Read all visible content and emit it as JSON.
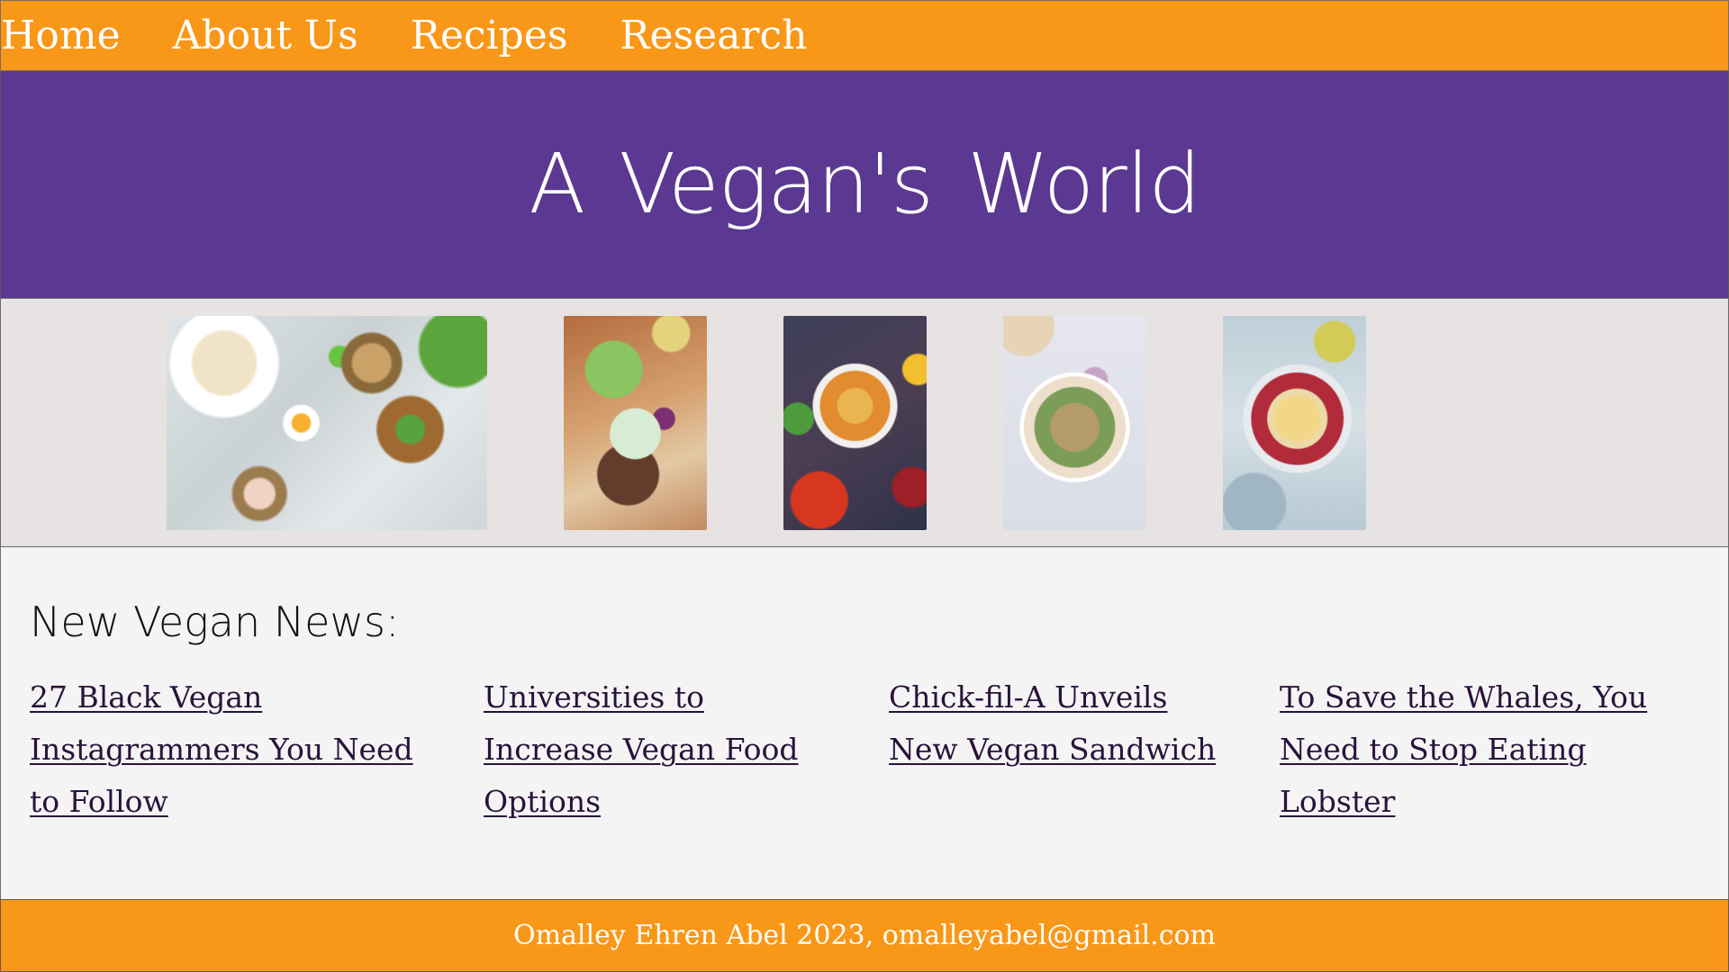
{
  "nav": {
    "items": [
      {
        "label": "Home"
      },
      {
        "label": "About Us"
      },
      {
        "label": "Recipes"
      },
      {
        "label": "Research"
      }
    ]
  },
  "header": {
    "title": "A Vegan's World"
  },
  "gallery": {
    "images": [
      {
        "icon": "food-photo"
      },
      {
        "icon": "food-photo"
      },
      {
        "icon": "food-photo"
      },
      {
        "icon": "food-photo"
      },
      {
        "icon": "food-photo"
      }
    ]
  },
  "news": {
    "title": "New Vegan News:",
    "links": [
      {
        "label": "27 Black Vegan Instagrammers You Need to Follow"
      },
      {
        "label": "Universities to Increase Vegan Food Options"
      },
      {
        "label": "Chick-fil-A Unveils New Vegan Sandwich"
      },
      {
        "label": "To Save the Whales, You Need to Stop Eating Lobster"
      }
    ]
  },
  "footer": {
    "text": "Omalley Ehren Abel 2023, omalleyabel@gmail.com"
  },
  "colors": {
    "nav_background": "#f99719",
    "header_background": "#5b3891",
    "gallery_background": "#e7e3e3",
    "page_background": "#f5f4f5",
    "link_color": "#28143a"
  }
}
